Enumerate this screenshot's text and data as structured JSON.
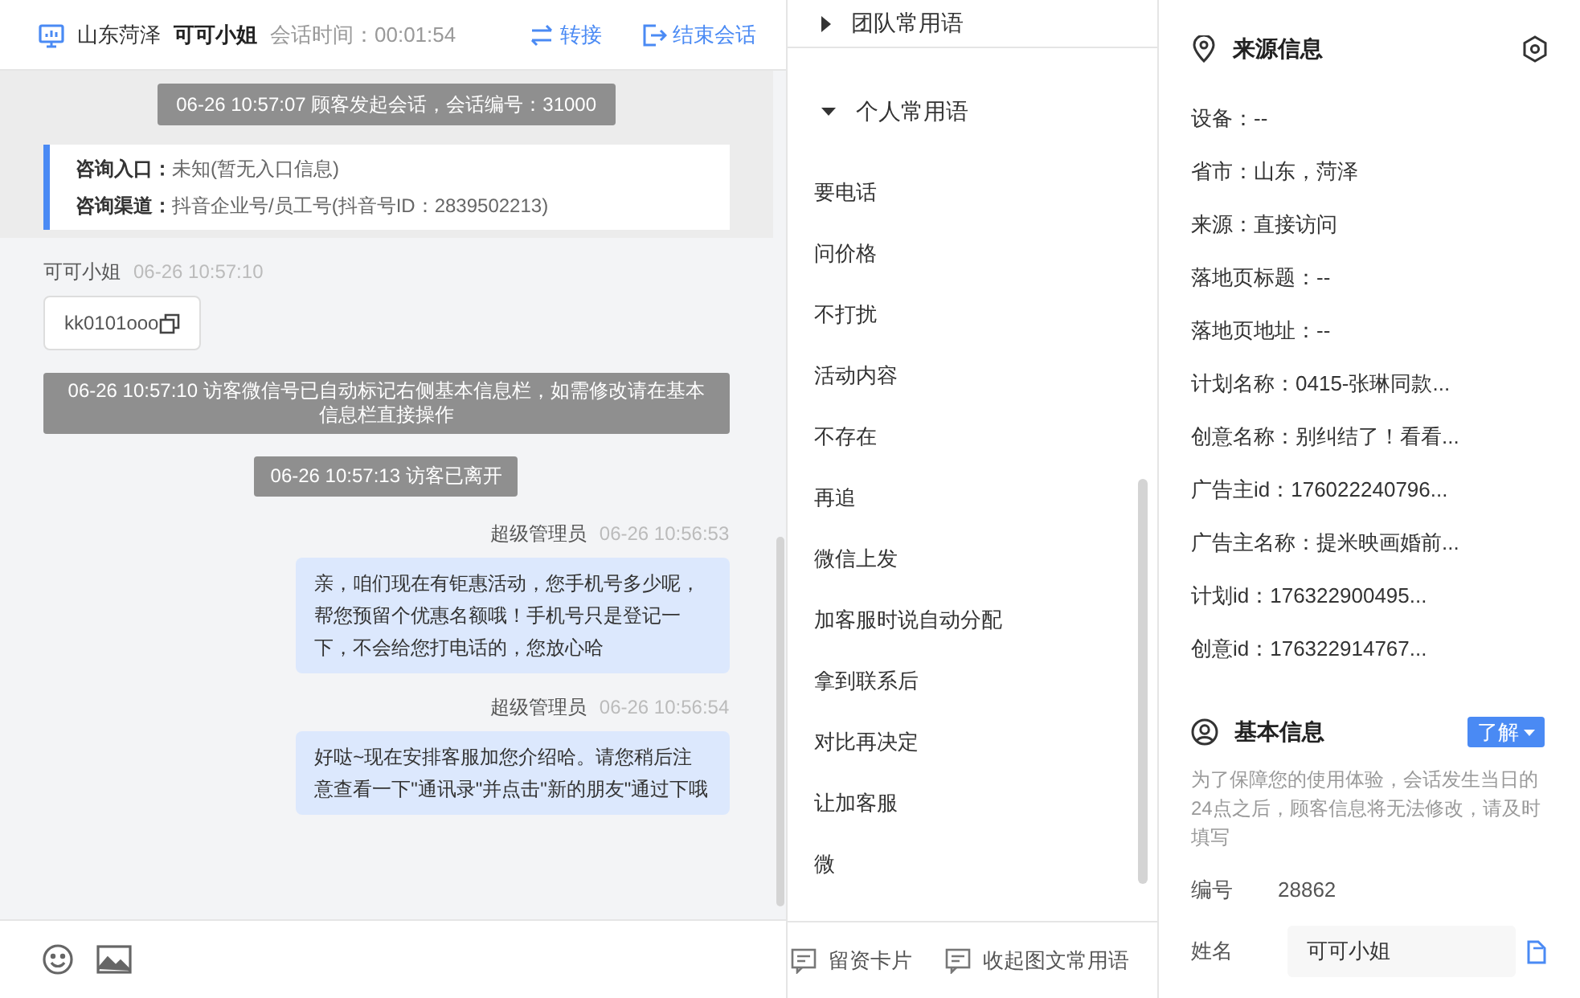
{
  "header": {
    "location": "山东菏泽",
    "name": "可可小姐",
    "duration_label": "会话时间：00:01:54",
    "actions": [
      {
        "kind": "transfer",
        "label": "转接"
      },
      {
        "kind": "end",
        "label": "结束会话"
      }
    ]
  },
  "chat": {
    "messages": [
      {
        "kind": "system",
        "text": "06-26 10:57:07 顾客发起会话，会话编号：31000"
      },
      {
        "kind": "info_card",
        "rows": [
          {
            "label": "咨询入口：",
            "value": "未知(暂无入口信息)"
          },
          {
            "label": "咨询渠道：",
            "value": "抖音企业号/员工号(抖音号ID：2839502213)"
          }
        ]
      },
      {
        "kind": "visitor",
        "sender": "可可小姐",
        "time": "06-26 10:57:10",
        "text": "kk0101ooo"
      },
      {
        "kind": "system",
        "text": "06-26 10:57:10 访客微信号已自动标记右侧基本信息栏，如需修改请在基本信息栏直接操作"
      },
      {
        "kind": "system",
        "text": "06-26 10:57:13 访客已离开"
      },
      {
        "kind": "agent",
        "sender": "超级管理员",
        "time": "06-26 10:56:53",
        "text": "亲，咱们现在有钜惠活动，您手机号多少呢，帮您预留个优惠名额哦！手机号只是登记一下，不会给您打电话的，您放心哈"
      },
      {
        "kind": "agent",
        "sender": "超级管理员",
        "time": "06-26 10:56:54",
        "text": "好哒~现在安排客服加您介绍哈。请您稍后注意查看一下\"通讯录\"并点击\"新的朋友\"通过下哦"
      }
    ]
  },
  "quick_phrases": {
    "groups": [
      {
        "label": "团队常用语",
        "expanded": false
      },
      {
        "label": "个人常用语",
        "expanded": true
      }
    ],
    "items": [
      "要电话",
      "问价格",
      "不打扰",
      "活动内容",
      "不存在",
      "再追",
      "微信上发",
      "加客服时说自动分配",
      "拿到联系后",
      "对比再决定",
      "让加客服",
      "微"
    ],
    "footer": [
      "留资卡片",
      "收起图文常用语"
    ]
  },
  "source_info": {
    "title": "来源信息",
    "rows": [
      "设备：--",
      "省市：山东，菏泽",
      "来源：直接访问",
      "落地页标题：--",
      "落地页地址：--",
      "计划名称：0415-张琳同款...",
      "创意名称：别纠结了！看看...",
      "广告主id：176022240796...",
      "广告主名称：提米映画婚前...",
      "计划id：176322900495...",
      "创意id：176322914767..."
    ]
  },
  "basic_info": {
    "title": "基本信息",
    "badge": "了解",
    "note": "为了保障您的使用体验，会话发生当日的24点之后，顾客信息将无法修改，请及时填写",
    "fields": [
      {
        "kind": "text",
        "label": "编号",
        "value": "28862"
      },
      {
        "kind": "input",
        "label": "姓名",
        "value": "可可小姐"
      }
    ]
  }
}
